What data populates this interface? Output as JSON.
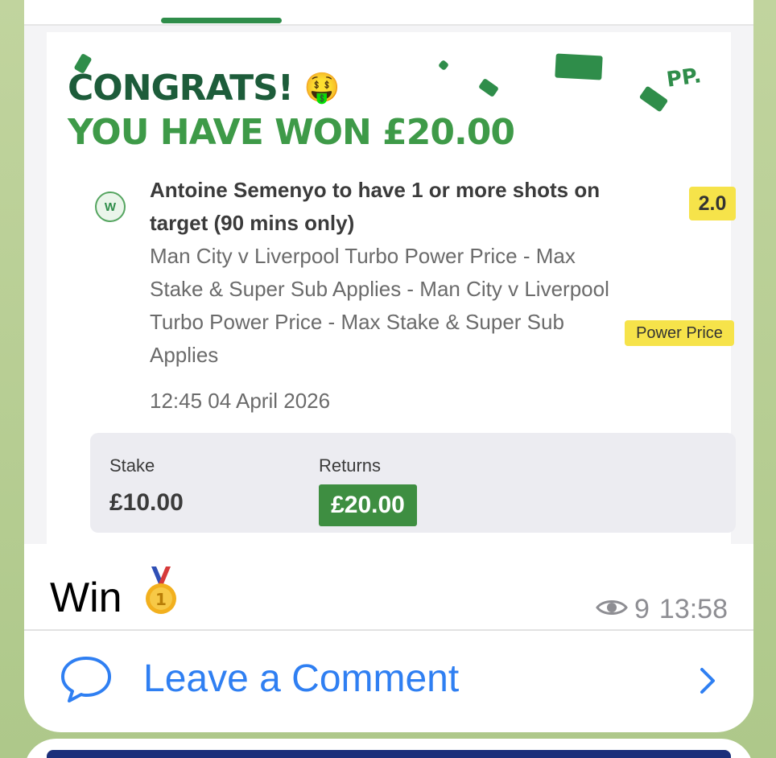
{
  "bet": {
    "headline": "CONGRATS!",
    "headline_emoji": "🤑",
    "win_line": "YOU HAVE WON £20.00",
    "status_badge": "W",
    "selection": "Antoine Semenyo to have 1 or more shots on target (90 mins only)",
    "market": "Man City v Liverpool Turbo Power Price - Max Stake & Super Sub Applies - Man City v Liverpool Turbo Power Price - Max Stake & Super Sub Applies",
    "datetime": "12:45 04 April 2026",
    "odds": "2.0",
    "price_tag": "Power Price",
    "decoration_text": "PP.",
    "stake_label": "Stake",
    "stake_value": "£10.00",
    "returns_label": "Returns",
    "returns_value": "£20.00"
  },
  "message": {
    "caption": "Win",
    "caption_emoji": "gold-medal",
    "views": "9",
    "time": "13:58"
  },
  "comments": {
    "label": "Leave a Comment"
  },
  "colors": {
    "brand_dark_green": "#1d5c3a",
    "brand_green": "#3e9a48",
    "highlight_yellow": "#f6e34a",
    "link_blue": "#2f7ff2",
    "meta_gray": "#8e8e93"
  }
}
